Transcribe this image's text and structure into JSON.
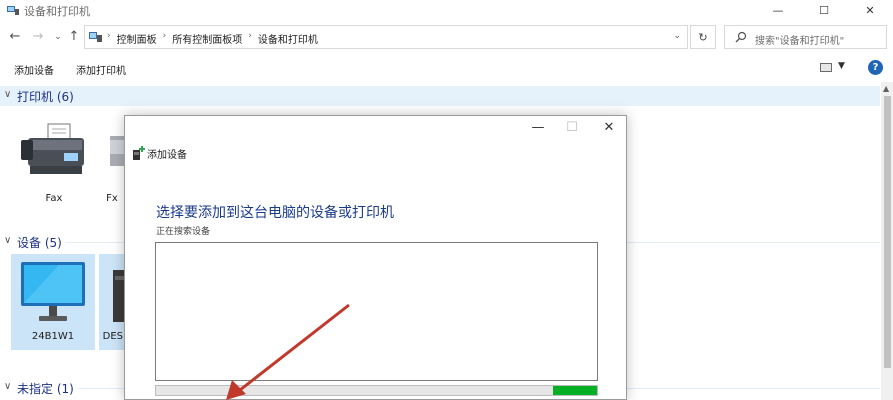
{
  "window": {
    "title": "设备和打印机",
    "controls": {
      "minimize": "—",
      "maximize": "☐",
      "close": "✕"
    }
  },
  "address": {
    "crumbs": [
      "控制面板",
      "所有控制面板项",
      "设备和打印机"
    ],
    "search_placeholder": "搜索\"设备和打印机\""
  },
  "commands": {
    "add_device": "添加设备",
    "add_printer": "添加打印机",
    "help": "?"
  },
  "groups": {
    "printers": {
      "title": "打印机 (6)"
    },
    "devices": {
      "title": "设备 (5)"
    },
    "unspecified": {
      "title": "未指定 (1)"
    }
  },
  "printers": [
    {
      "label": "Fax"
    },
    {
      "label": "Fx"
    }
  ],
  "devices": [
    {
      "label": "24B1W1"
    },
    {
      "label": "DES"
    }
  ],
  "dialog": {
    "title": "添加设备",
    "heading": "选择要添加到这台电脑的设备或打印机",
    "status": "正在搜索设备",
    "progress": 0.1,
    "colors": {
      "progress_fill": "#06b025",
      "heading": "#1a3a8c"
    }
  },
  "colors": {
    "accent": "#1f64b5",
    "group_header_bg": "#e5f1fb",
    "arrow": "#c0392b"
  }
}
